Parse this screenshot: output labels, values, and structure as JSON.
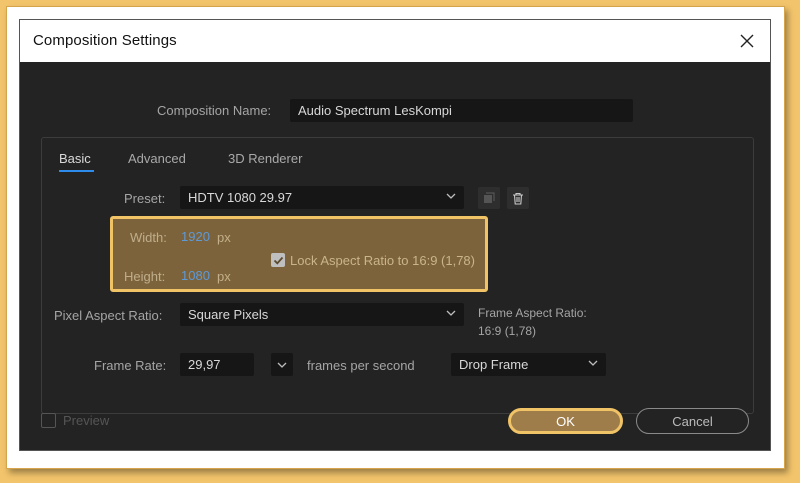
{
  "dialog": {
    "title": "Composition Settings",
    "close_icon": "close-icon"
  },
  "composition_name": {
    "label": "Composition Name:",
    "value": "Audio Spectrum LesKompi"
  },
  "tabs": [
    {
      "label": "Basic",
      "active": true
    },
    {
      "label": "Advanced",
      "active": false
    },
    {
      "label": "3D Renderer",
      "active": false
    }
  ],
  "preset": {
    "label": "Preset:",
    "value": "HDTV 1080 29.97",
    "save_icon": "save-preset-icon",
    "delete_icon": "trash-icon"
  },
  "dimensions": {
    "width_label": "Width:",
    "width_value": "1920",
    "width_unit": "px",
    "height_label": "Height:",
    "height_value": "1080",
    "height_unit": "px",
    "lock_label": "Lock Aspect Ratio to 16:9 (1,78)",
    "lock_checked": true
  },
  "pixel_aspect": {
    "label": "Pixel Aspect Ratio:",
    "value": "Square Pixels",
    "frame_aspect_label": "Frame Aspect Ratio:",
    "frame_aspect_value": "16:9 (1,78)"
  },
  "frame_rate": {
    "label": "Frame Rate:",
    "value": "29,97",
    "unit_label": "frames per second",
    "drop_value": "Drop Frame"
  },
  "footer": {
    "preview_label": "Preview",
    "ok_label": "OK",
    "cancel_label": "Cancel"
  },
  "colors": {
    "accent_blue": "#2d8ceb",
    "highlight": "#f0c367",
    "dialog_bg": "#232323"
  }
}
